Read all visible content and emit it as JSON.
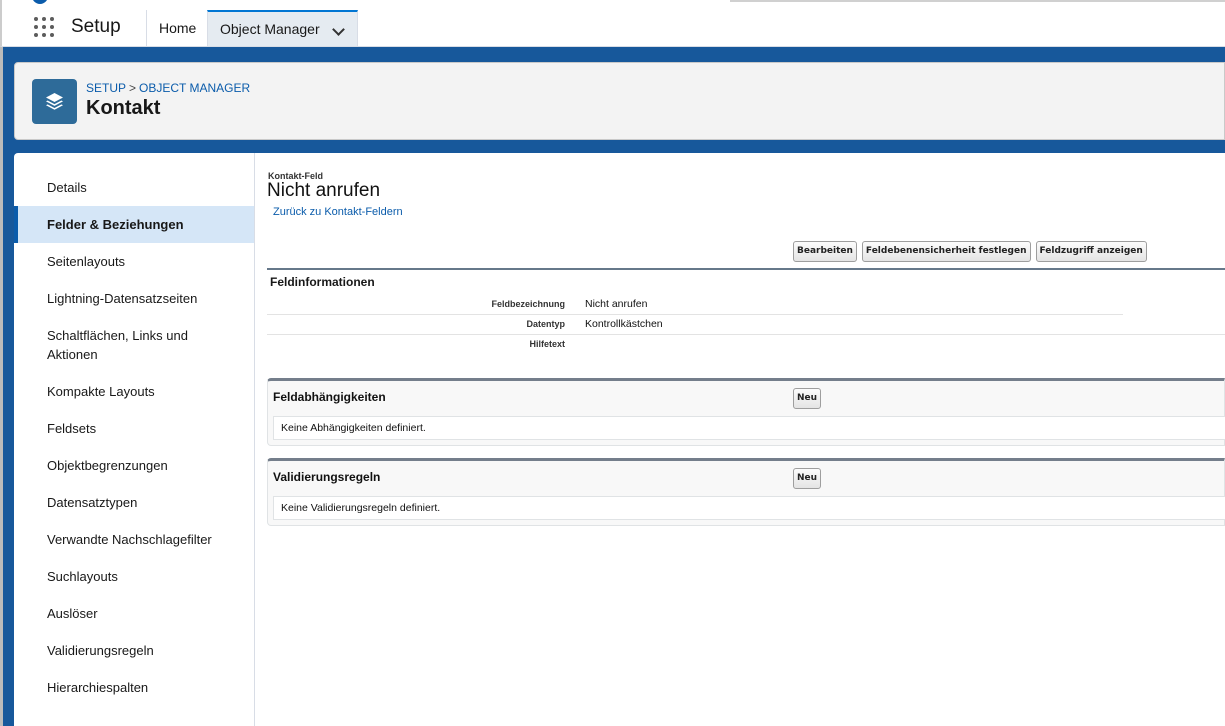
{
  "header": {
    "app_name": "Setup",
    "tabs": [
      {
        "label": "Home"
      },
      {
        "label": "Object Manager"
      }
    ]
  },
  "object_header": {
    "breadcrumb": {
      "setup": "SETUP",
      "separator": ">",
      "object_manager": "OBJECT MANAGER"
    },
    "title": "Kontakt",
    "icon": "layers-icon"
  },
  "sidebar": {
    "items": [
      {
        "label": "Details"
      },
      {
        "label": "Felder & Beziehungen",
        "active": true
      },
      {
        "label": "Seitenlayouts"
      },
      {
        "label": "Lightning-Datensatzseiten"
      },
      {
        "label": "Schaltflächen, Links und Aktionen"
      },
      {
        "label": "Kompakte Layouts"
      },
      {
        "label": "Feldsets"
      },
      {
        "label": "Objektbegrenzungen"
      },
      {
        "label": "Datensatztypen"
      },
      {
        "label": "Verwandte Nachschlagefilter"
      },
      {
        "label": "Suchlayouts"
      },
      {
        "label": "Auslöser"
      },
      {
        "label": "Validierungsregeln"
      },
      {
        "label": "Hierarchiespalten"
      }
    ]
  },
  "field_page": {
    "eyebrow": "Kontakt-Feld",
    "title": "Nicht anrufen",
    "back_link": "Zurück zu Kontakt-Feldern",
    "buttons": {
      "edit": "Bearbeiten",
      "field_security": "Feldebenensicherheit festlegen",
      "field_access": "Feldzugriff anzeigen"
    },
    "info_section": {
      "title": "Feldinformationen",
      "rows": [
        {
          "label": "Feldbezeichnung",
          "value": "Nicht anrufen"
        },
        {
          "label": "Datentyp",
          "value": "Kontrollkästchen"
        },
        {
          "label": "Hilfetext",
          "value": ""
        }
      ]
    },
    "related_lists": [
      {
        "title": "Feldabhängigkeiten",
        "button": "Neu",
        "empty_text": "Keine Abhängigkeiten definiert."
      },
      {
        "title": "Validierungsregeln",
        "button": "Neu",
        "empty_text": "Keine Validierungsregeln definiert."
      }
    ]
  },
  "colors": {
    "brand_band": "#17589b",
    "link": "#0b5cab",
    "active_nav_bg": "#d5e6f7",
    "object_icon": "#2e6b99"
  }
}
